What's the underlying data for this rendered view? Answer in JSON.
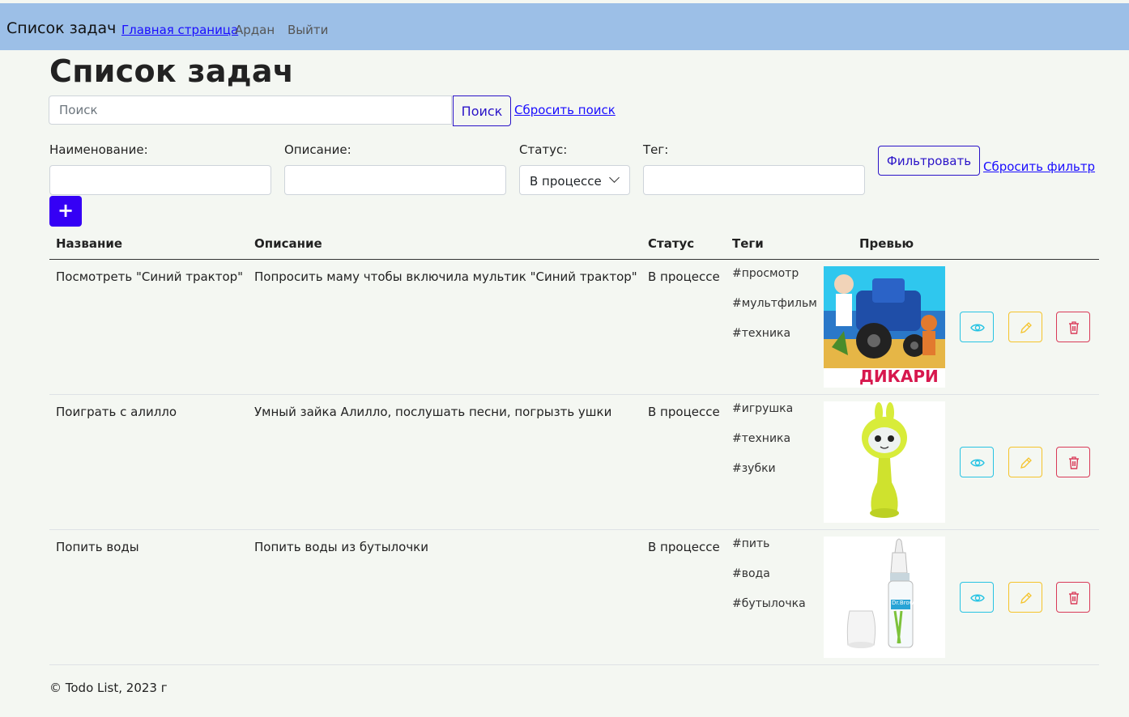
{
  "navbar": {
    "brand": "Список задач",
    "home_link": "Главная страница",
    "user": "Ардан",
    "logout": "Выйти"
  },
  "page_title": "Список задач",
  "search": {
    "placeholder": "Поиск",
    "value": "",
    "button": "Поиск",
    "reset": "Сбросить поиск"
  },
  "filter": {
    "name_label": "Наименование:",
    "name_value": "",
    "description_label": "Описание:",
    "description_value": "",
    "status_label": "Статус:",
    "status_value": "В процессе",
    "tag_label": "Тег:",
    "tag_value": "",
    "filter_button": "Фильтровать",
    "reset": "Сбросить фильтр"
  },
  "add_button": "+",
  "table": {
    "headers": [
      "Название",
      "Описание",
      "Статус",
      "Теги",
      "Превью"
    ],
    "rows": [
      {
        "name": "Посмотреть \"Синий трактор\"",
        "description": "Попросить маму чтобы включила мультик \"Синий трактор\"",
        "status": "В процессе",
        "tags": [
          "#просмотр",
          "#мультфильм",
          "#техника"
        ],
        "preview_caption": "ДИКАРИ"
      },
      {
        "name": "Поиграть с алилло",
        "description": "Умный зайка Алилло, послушать песни, погрызть ушки",
        "status": "В процессе",
        "tags": [
          "#игрушка",
          "#техника",
          "#зубки"
        ],
        "preview_caption": ""
      },
      {
        "name": "Попить воды",
        "description": "Попить воды из бутылочки",
        "status": "В процессе",
        "tags": [
          "#пить",
          "#вода",
          "#бутылочка"
        ],
        "preview_caption": "Dr.Brown's"
      }
    ]
  },
  "footer": "© Todo List, 2023 г",
  "colors": {
    "navbar": "#9cbfe7",
    "primary": "#3500f5",
    "view": "#27c3e3",
    "edit": "#f5c32a",
    "delete": "#d93a58"
  }
}
